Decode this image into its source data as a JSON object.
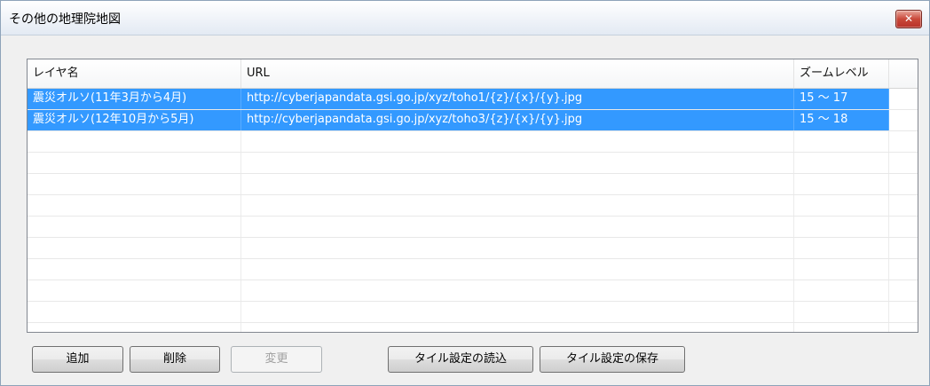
{
  "window": {
    "title": "その他の地理院地図",
    "close_glyph": "✕"
  },
  "list": {
    "columns": [
      "レイヤ名",
      "URL",
      "ズームレベル",
      ""
    ],
    "rows": [
      {
        "name": "震災オルソ(11年3月から4月)",
        "url": "http://cyberjapandata.gsi.go.jp/xyz/toho1/{z}/{x}/{y}.jpg",
        "zoom": "15 〜 17",
        "selected": true
      },
      {
        "name": "震災オルソ(12年10月から5月)",
        "url": "http://cyberjapandata.gsi.go.jp/xyz/toho3/{z}/{x}/{y}.jpg",
        "zoom": "15 〜 18",
        "selected": true
      }
    ],
    "selection_color": "#3399ff"
  },
  "buttons": {
    "add": "追加",
    "delete": "削除",
    "change": "変更",
    "load": "タイル設定の読込",
    "save": "タイル設定の保存"
  }
}
